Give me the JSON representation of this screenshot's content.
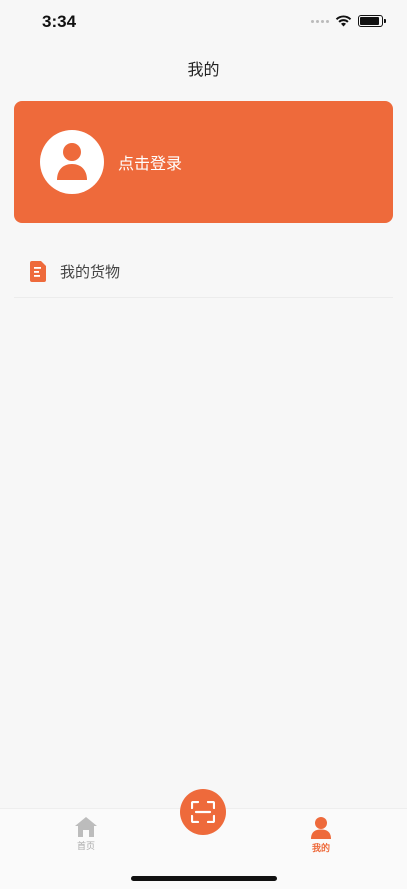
{
  "status_bar": {
    "time": "3:34"
  },
  "nav": {
    "title": "我的"
  },
  "profile_card": {
    "login_label": "点击登录",
    "background_color": "#ee6a3b"
  },
  "menu": {
    "items": [
      {
        "label": "我的货物",
        "icon": "document-icon"
      }
    ]
  },
  "tab_bar": {
    "tabs": [
      {
        "label": "首页",
        "icon": "home-icon",
        "active": false
      },
      {
        "label": "",
        "icon": "scan-icon",
        "active": false
      },
      {
        "label": "我的",
        "icon": "person-icon",
        "active": true
      }
    ],
    "accent_color": "#ee6a3b",
    "inactive_color": "#aaaaaa"
  }
}
